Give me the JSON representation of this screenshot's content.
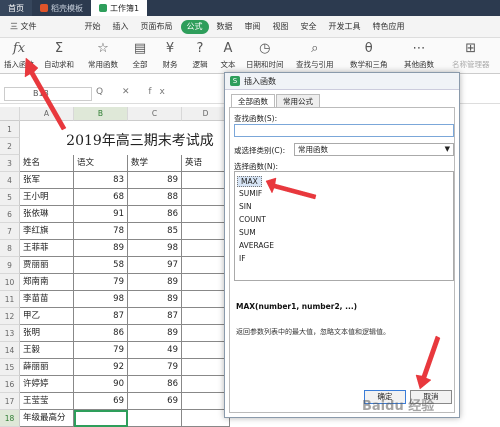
{
  "tabs": [
    "首页",
    "稻壳模板",
    "工作簿1"
  ],
  "menu": [
    "三 文件",
    "开始",
    "插入",
    "页面布局",
    "公式",
    "数据",
    "审阅",
    "视图",
    "安全",
    "开发工具",
    "特色应用"
  ],
  "active_menu": "公式",
  "ribbon": {
    "insert_fn": "插入函数",
    "autosum": "自动求和",
    "common": "常用函数",
    "all": "全部",
    "finance": "财务",
    "logic": "逻辑",
    "text": "文本",
    "datetime": "日期和时间",
    "lookup": "查找与引用",
    "math": "数学和三角",
    "other": "其他函数",
    "name_mgr": "名称管理器"
  },
  "formula_bar": {
    "name_box": "B18",
    "icons": "Q ✕ fx"
  },
  "columns": [
    "A",
    "B",
    "C",
    "D"
  ],
  "title": "2019年高三期末考试成",
  "header_row": [
    "姓名",
    "语文",
    "数学",
    "英语"
  ],
  "rows": [
    {
      "n": "张军",
      "a": "83",
      "b": "89"
    },
    {
      "n": "王小明",
      "a": "68",
      "b": "88"
    },
    {
      "n": "张依琳",
      "a": "91",
      "b": "86"
    },
    {
      "n": "李红旗",
      "a": "78",
      "b": "85"
    },
    {
      "n": "王菲菲",
      "a": "89",
      "b": "98"
    },
    {
      "n": "贾丽丽",
      "a": "58",
      "b": "97"
    },
    {
      "n": "郑南南",
      "a": "79",
      "b": "89"
    },
    {
      "n": "李苗苗",
      "a": "98",
      "b": "89"
    },
    {
      "n": "甲乙",
      "a": "87",
      "b": "87"
    },
    {
      "n": "张明",
      "a": "86",
      "b": "89"
    },
    {
      "n": "王毅",
      "a": "79",
      "b": "49"
    },
    {
      "n": "薛丽丽",
      "a": "92",
      "b": "79"
    },
    {
      "n": "许婷婷",
      "a": "90",
      "b": "86"
    },
    {
      "n": "王莹莹",
      "a": "69",
      "b": "69"
    }
  ],
  "last_row_label": "年级最高分",
  "row_numbers": [
    "1",
    "2",
    "3",
    "4",
    "5",
    "6",
    "7",
    "8",
    "9",
    "10",
    "11",
    "12",
    "13",
    "14",
    "15",
    "16",
    "17",
    "18"
  ],
  "dialog": {
    "title": "插入函数",
    "tabs": [
      "全部函数",
      "常用公式"
    ],
    "search_label": "查找函数(S):",
    "category_label": "或选择类别(C):",
    "category_value": "常用函数",
    "select_label": "选择函数(N):",
    "functions": [
      "MAX",
      "SUMIF",
      "SIN",
      "COUNT",
      "SUM",
      "AVERAGE",
      "IF"
    ],
    "signature": "MAX(number1, number2, ...)",
    "description": "返回参数列表中的最大值，忽略文本值和逻辑值。",
    "ok": "确定",
    "cancel": "取消"
  },
  "watermark": "Baidu 经验"
}
